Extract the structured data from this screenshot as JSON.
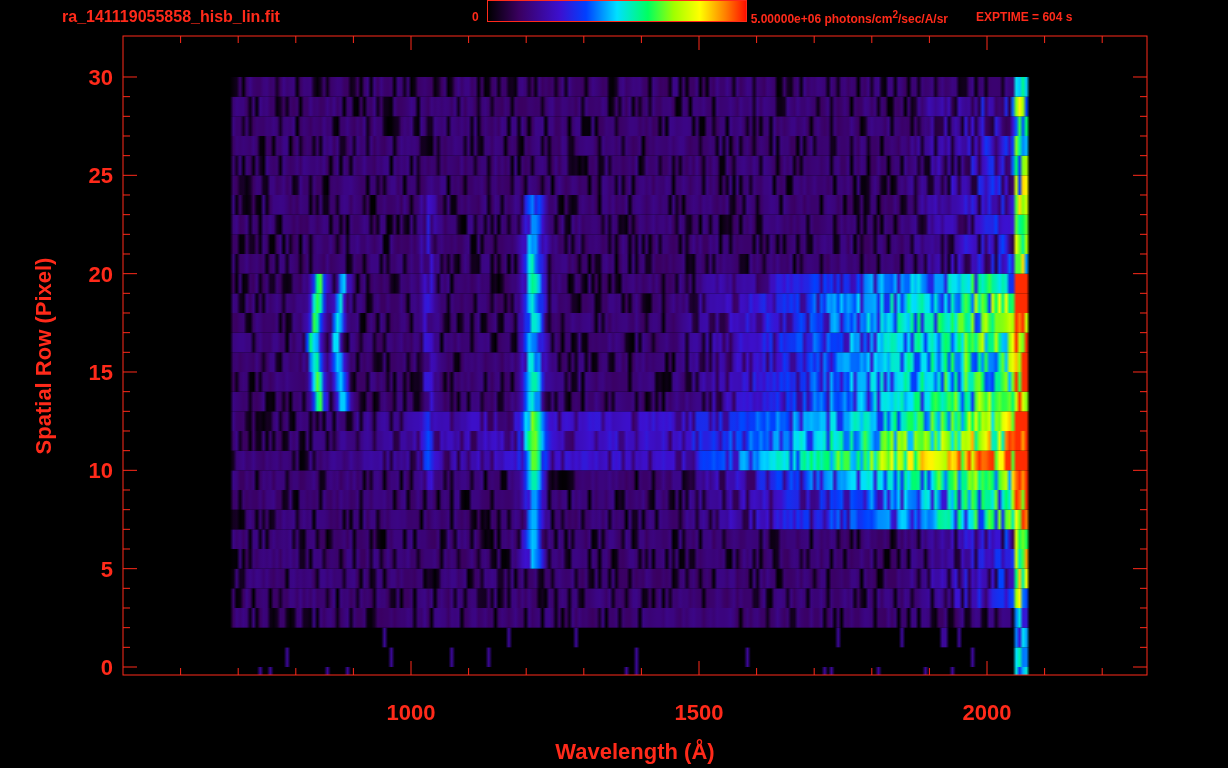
{
  "header": {
    "title": "ra_141119055858_hisb_lin.fit",
    "colorbar_min": "0",
    "colorbar_label": "5.00000e+06 photons/cm$^{2}$/sec/A/sr",
    "exptime": "EXPTIME = 604 s"
  },
  "plot": {
    "xlabel": "Wavelength (Å)",
    "ylabel": "Spatial Row (Pixel)",
    "xticks": [
      "1000",
      "1500",
      "2000"
    ],
    "yticks": [
      "30",
      "25",
      "20",
      "15",
      "10",
      "5",
      "0"
    ]
  }
}
